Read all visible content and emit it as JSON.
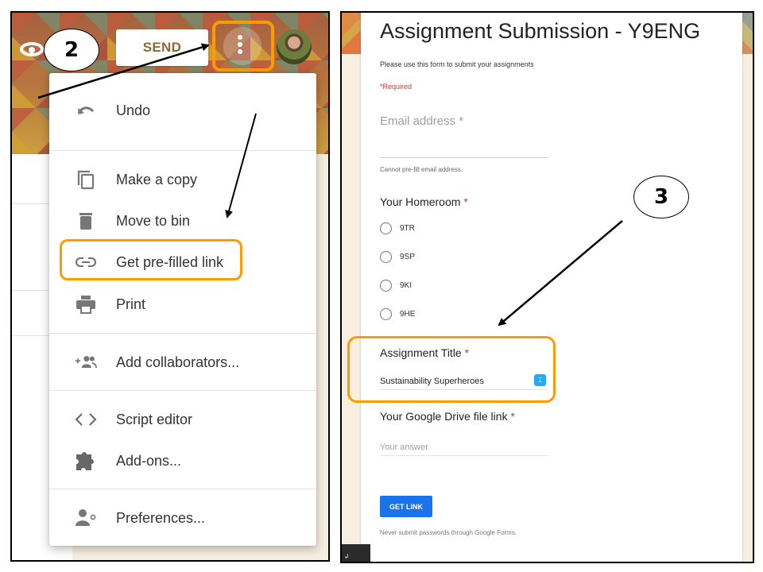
{
  "left_panel": {
    "header": {
      "preview_icon": "eye-icon",
      "send_label": "SEND",
      "more_icon": "more-vert-icon",
      "avatar_icon": "user-avatar"
    },
    "menu": {
      "items": [
        {
          "label": "Undo",
          "icon": "undo-icon"
        },
        {
          "label": "Make a copy",
          "icon": "copy-icon"
        },
        {
          "label": "Move to bin",
          "icon": "trash-icon"
        },
        {
          "label": "Get pre-filled link",
          "icon": "link-icon",
          "highlighted": true
        },
        {
          "label": "Print",
          "icon": "print-icon"
        },
        {
          "label": "Add collaborators...",
          "icon": "add-people-icon"
        },
        {
          "label": "Script editor",
          "icon": "code-icon"
        },
        {
          "label": "Add-ons...",
          "icon": "puzzle-icon"
        },
        {
          "label": "Preferences...",
          "icon": "person-settings-icon"
        }
      ]
    },
    "annotation": {
      "step": "2"
    }
  },
  "right_panel": {
    "form": {
      "title": "Assignment Submission - Y9ENG",
      "description": "Please use this form to submit your assignments",
      "required_note": "*Required",
      "email": {
        "label": "Email address",
        "star": "*",
        "note": "Cannot pre-fill email address."
      },
      "homeroom": {
        "label": "Your Homeroom",
        "star": "*",
        "options": [
          "9TR",
          "9SP",
          "9KI",
          "9HE"
        ]
      },
      "assignment_title": {
        "label": "Assignment Title",
        "star": "*",
        "value": "Sustainability Superheroes",
        "highlighted": true
      },
      "drive_link": {
        "label": "Your Google Drive file link",
        "star": "*",
        "placeholder": "Your answer"
      },
      "get_link_label": "GET LINK",
      "footer_note": "Never submit passwords through Google Forms."
    },
    "annotation": {
      "step": "3"
    }
  },
  "colors": {
    "highlight": "#ff9b00",
    "required": "#d93025",
    "primary_button": "#1a73e8",
    "send_text": "#8a6a3a"
  }
}
